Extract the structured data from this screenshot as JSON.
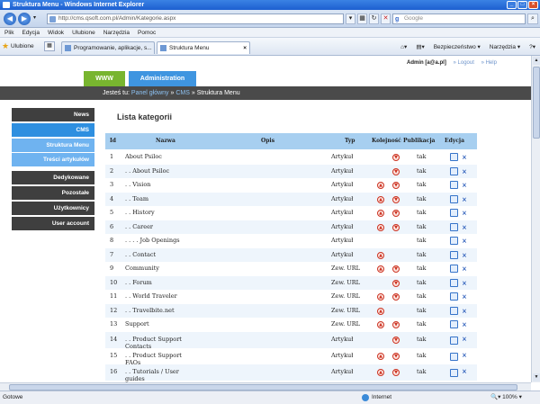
{
  "window": {
    "title": "Struktura Menu - Windows Internet Explorer"
  },
  "browser": {
    "url": "http://cms.qsoft.com.pl/Admin/Kategorie.aspx",
    "search_placeholder": "Google",
    "menu": [
      "Plik",
      "Edycja",
      "Widok",
      "Ulubione",
      "Narzędzia",
      "Pomoc"
    ],
    "favorites_label": "Ulubione",
    "tabs": [
      {
        "label": "Programowanie, aplikacje, s...",
        "active": false
      },
      {
        "label": "Struktura Menu",
        "active": true
      }
    ],
    "commands": [
      "Bezpieczeństwo ▾",
      "Narzędzia ▾",
      "?▾"
    ],
    "status_text": "Gotowe",
    "zone": "Internet",
    "zoom": "100%"
  },
  "site": {
    "user": "Admin [a@a.pl]",
    "logout": "Logout",
    "help": "Help",
    "btn_www": "WWW",
    "btn_admin": "Administration",
    "breadcrumb": {
      "prefix": "Jesteś tu:",
      "home": "Panel główny",
      "sep": "»",
      "section": "CMS",
      "current": "Struktura Menu"
    },
    "sidebar": [
      {
        "label": "News",
        "state": "normal"
      },
      {
        "label": "CMS",
        "state": "selected"
      },
      {
        "label": "Struktura Menu",
        "state": "sub"
      },
      {
        "label": "Treści artykułów",
        "state": "sub"
      },
      {
        "label": "Dedykowane",
        "state": "normal"
      },
      {
        "label": "Pozostałe",
        "state": "normal"
      },
      {
        "label": "Użytkownicy",
        "state": "normal"
      },
      {
        "label": "User account",
        "state": "normal"
      }
    ],
    "page_title": "Lista kategorii",
    "columns": {
      "id": "Id",
      "name": "Nazwa",
      "desc": "Opis",
      "type": "Typ",
      "order": "Kolejność",
      "pub": "Publikacja",
      "edit": "Edycja"
    },
    "rows": [
      {
        "id": "1",
        "name": "About Psiloc",
        "type": "Artykuł",
        "up": false,
        "down": true,
        "pub": "tak"
      },
      {
        "id": "2",
        "name": ". . About Psiloc",
        "type": "Artykuł",
        "up": false,
        "down": true,
        "pub": "tak"
      },
      {
        "id": "3",
        "name": ". . Vision",
        "type": "Artykuł",
        "up": true,
        "down": true,
        "pub": "tak"
      },
      {
        "id": "4",
        "name": ". . Team",
        "type": "Artykuł",
        "up": true,
        "down": true,
        "pub": "tak"
      },
      {
        "id": "5",
        "name": ". . History",
        "type": "Artykuł",
        "up": true,
        "down": true,
        "pub": "tak"
      },
      {
        "id": "6",
        "name": ". . Career",
        "type": "Artykuł",
        "up": true,
        "down": true,
        "pub": "tak"
      },
      {
        "id": "8",
        "name": ". . . . Job Openings",
        "type": "Artykuł",
        "up": false,
        "down": false,
        "pub": "tak"
      },
      {
        "id": "7",
        "name": ". . Contact",
        "type": "Artykuł",
        "up": true,
        "down": false,
        "pub": "tak"
      },
      {
        "id": "9",
        "name": "Community",
        "type": "Zew. URL",
        "up": true,
        "down": true,
        "pub": "tak"
      },
      {
        "id": "10",
        "name": ". . Forum",
        "type": "Zew. URL",
        "up": false,
        "down": true,
        "pub": "tak"
      },
      {
        "id": "11",
        "name": ". . World Traveler",
        "type": "Zew. URL",
        "up": true,
        "down": true,
        "pub": "tak"
      },
      {
        "id": "12",
        "name": ". . Travelbite.net",
        "type": "Zew. URL",
        "up": true,
        "down": false,
        "pub": "tak"
      },
      {
        "id": "13",
        "name": "Support",
        "type": "Zew. URL",
        "up": true,
        "down": true,
        "pub": "tak"
      },
      {
        "id": "14",
        "name": ". . Product Support Contacts",
        "type": "Artykuł",
        "up": false,
        "down": true,
        "pub": "tak"
      },
      {
        "id": "15",
        "name": ". . Product Support FAQs",
        "type": "Artykuł",
        "up": true,
        "down": true,
        "pub": "tak"
      },
      {
        "id": "16",
        "name": ". . Tutorials / User guides",
        "type": "Artykuł",
        "up": true,
        "down": true,
        "pub": "tak"
      }
    ]
  },
  "colors": {
    "green": "#78b52f",
    "blue": "#3f95e0",
    "dark": "#3f3f3f",
    "header": "#a7cff0"
  }
}
